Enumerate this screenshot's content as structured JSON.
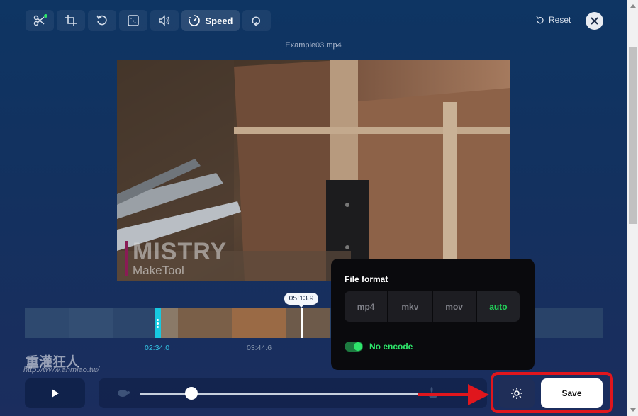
{
  "toolbar": {
    "tools": [
      {
        "name": "cut",
        "icon": "scissors-icon",
        "active_dot": true
      },
      {
        "name": "crop",
        "icon": "crop-icon"
      },
      {
        "name": "rotate",
        "icon": "rotate-icon"
      },
      {
        "name": "resize",
        "icon": "resize-icon"
      },
      {
        "name": "volume",
        "icon": "volume-icon"
      },
      {
        "name": "speed",
        "icon": "speed-icon",
        "label": "Speed",
        "active": true
      },
      {
        "name": "loop",
        "icon": "loop-icon"
      }
    ],
    "reset_label": "Reset"
  },
  "video": {
    "filename": "Example03.mp4",
    "watermark_title": "MISTRY",
    "watermark_subtitle": "MakeTool"
  },
  "timeline": {
    "playhead_time": "05:13.9",
    "start_time": "02:34.0",
    "mid_time": "03:44.6"
  },
  "popover": {
    "title": "File format",
    "formats": [
      "mp4",
      "mkv",
      "mov",
      "auto"
    ],
    "selected_format": "auto",
    "no_encode_label": "No encode",
    "no_encode_enabled": true
  },
  "controls": {
    "save_label": "Save",
    "speed_level": 0.17
  },
  "watermark": {
    "site_name": "重灌狂人",
    "site_url": "http://www.ahmiao.tw/"
  },
  "colors": {
    "accent_green": "#2ee66b",
    "handle_cyan": "#17c9e0",
    "highlight_red": "#e0161d"
  }
}
